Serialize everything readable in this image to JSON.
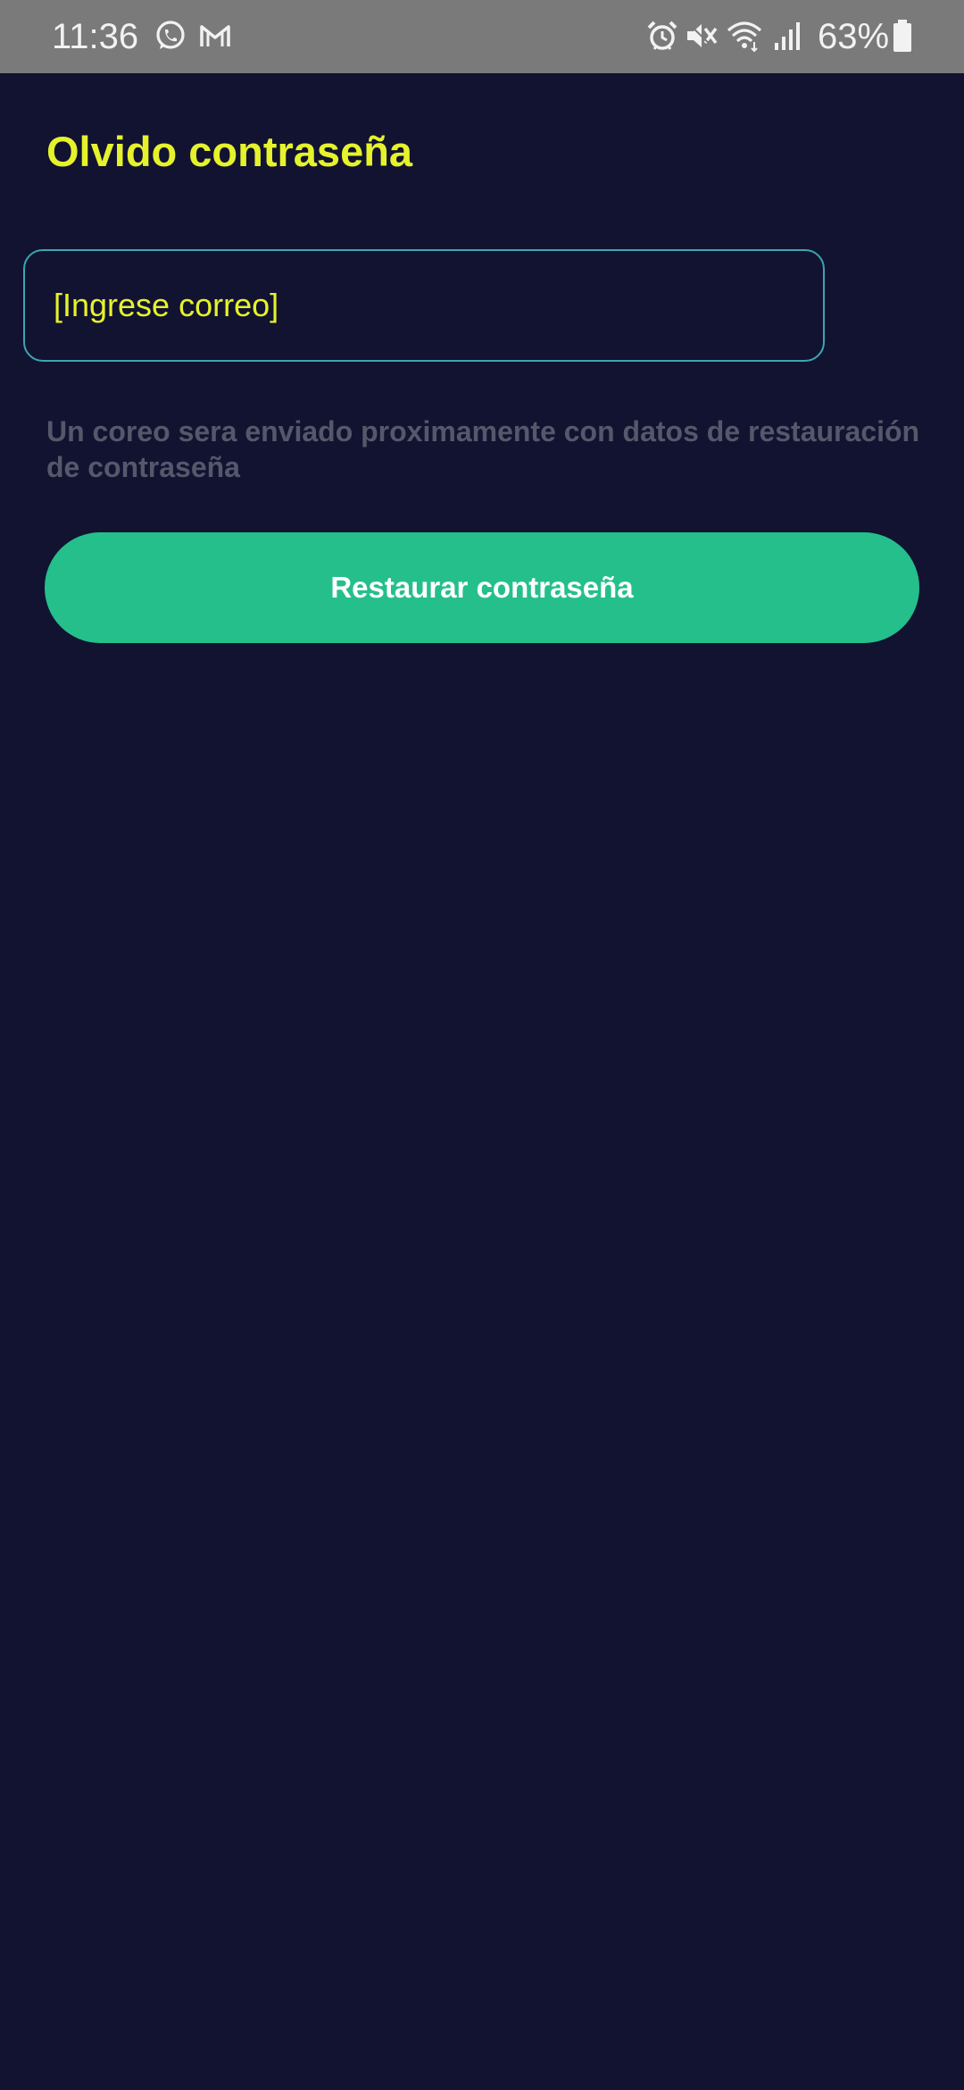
{
  "status_bar": {
    "time": "11:36",
    "battery": "63%",
    "background_color": "#7a7a7a",
    "left_icons": [
      "whatsapp-icon",
      "gmail-icon"
    ],
    "right_icons": [
      "alarm-icon",
      "mute-icon",
      "wifi-icon",
      "signal-icon",
      "battery-icon"
    ]
  },
  "screen": {
    "title": "Olvido contraseña",
    "email_input": {
      "placeholder": "[Ingrese correo]",
      "value": ""
    },
    "info_text": "Un coreo sera enviado proximamente con datos de restauración de contraseña",
    "reset_button_label": "Restaurar contraseña"
  },
  "colors": {
    "background": "#111331",
    "accent_yellow": "#e6f22b",
    "input_border": "#3aa6b0",
    "button": "#25bf8c",
    "muted_text": "#55586a"
  }
}
